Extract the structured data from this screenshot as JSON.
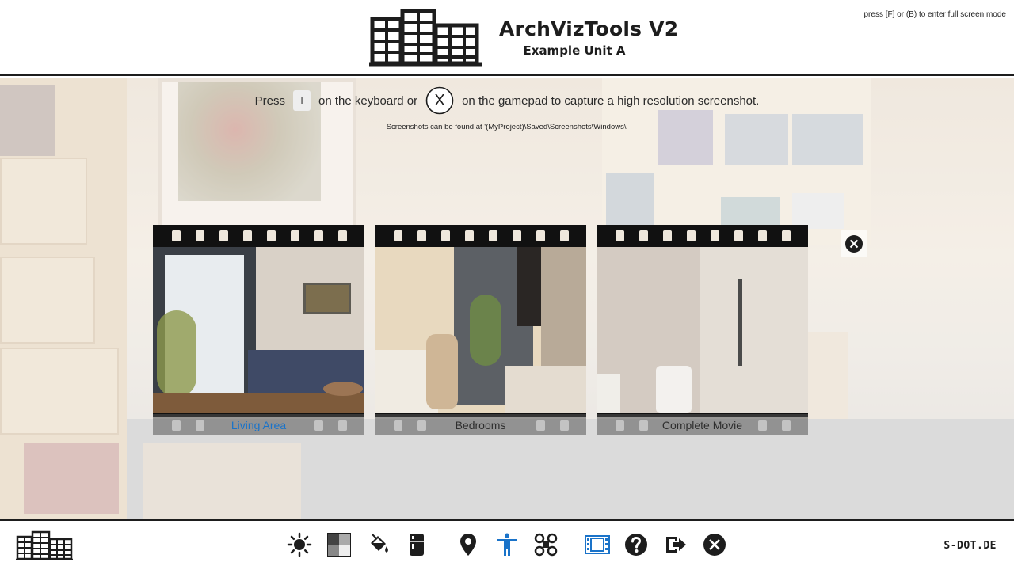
{
  "header": {
    "title": "ArchVizTools V2",
    "subtitle": "Example Unit A",
    "fullscreen_hint": "press [F] or (B) to enter full screen mode"
  },
  "capture": {
    "press": "Press",
    "key": "I",
    "on_keyboard": "on the keyboard or",
    "gamepad_button": "X",
    "on_gamepad": "on the gamepad to capture a high resolution screenshot.",
    "path_note": "Screenshots can be found at '(MyProject)\\Saved\\Screenshots\\Windows\\'"
  },
  "movies": [
    {
      "label": "Living Area",
      "active": true
    },
    {
      "label": "Bedrooms",
      "active": false
    },
    {
      "label": "Complete Movie",
      "active": false
    }
  ],
  "toolbar": {
    "icons": [
      "sun-icon",
      "material-grid-icon",
      "paint-bucket-icon",
      "fridge-icon",
      "location-pin-icon",
      "walk-mode-icon",
      "drone-icon",
      "film-icon",
      "help-icon",
      "exit-icon",
      "close-icon"
    ],
    "active_icons": [
      "walk-mode-icon",
      "film-icon"
    ],
    "brand": "S-DOT.DE"
  },
  "colors": {
    "accent": "#1a73c9",
    "dark": "#1d1d1d"
  }
}
